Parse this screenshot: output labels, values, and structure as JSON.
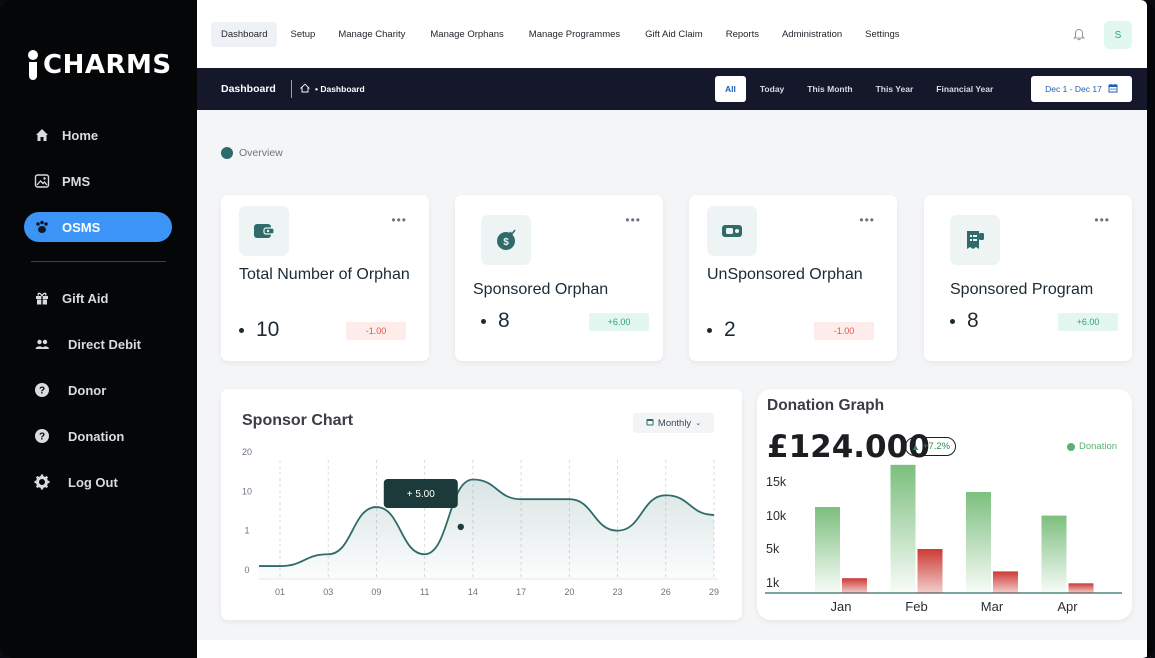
{
  "app": {
    "logo_text": "CHARMS"
  },
  "sidebar": {
    "items": [
      {
        "label": "Home",
        "icon": "home-icon",
        "active": false
      },
      {
        "label": "PMS",
        "icon": "image-icon",
        "active": false
      },
      {
        "label": "OSMS",
        "icon": "paw-icon",
        "active": true
      },
      {
        "label": "Gift Aid",
        "icon": "gift-icon",
        "active": false
      },
      {
        "label": "Direct Debit",
        "icon": "users-icon",
        "active": false
      },
      {
        "label": "Donor",
        "icon": "help-icon",
        "active": false
      },
      {
        "label": "Donation",
        "icon": "help-icon",
        "active": false
      },
      {
        "label": "Log Out",
        "icon": "gear-icon",
        "active": false
      }
    ]
  },
  "topnav": {
    "items": [
      "Dashboard",
      "Setup",
      "Manage Charity",
      "Manage Orphans",
      "Manage Programmes",
      "Gift Aid Claim",
      "Reports",
      "Administration",
      "Settings"
    ],
    "active": "Dashboard",
    "avatar_initial": "S"
  },
  "header": {
    "title": "Dashboard",
    "breadcrumb": "• Dashboard",
    "filters": [
      "All",
      "Today",
      "This Month",
      "This Year",
      "Financial Year"
    ],
    "active_filter": "All",
    "date_range": "Dec 1 - Dec 17"
  },
  "overview": {
    "label": "Overview"
  },
  "cards": [
    {
      "title": "Total Number of Orphan",
      "value": "10",
      "change": "-1.00",
      "trend": "neg",
      "icon": "wallet-icon"
    },
    {
      "title": "Sponsored Orphan",
      "value": "8",
      "change": "+6.00",
      "trend": "pos",
      "icon": "money-bag-icon"
    },
    {
      "title": "UnSponsored Orphan",
      "value": "2",
      "change": "-1.00",
      "trend": "neg",
      "icon": "cash-icon"
    },
    {
      "title": "Sponsored Program",
      "value": "8",
      "change": "+6.00",
      "trend": "pos",
      "icon": "receipt-icon"
    }
  ],
  "sponsor_chart": {
    "title": "Sponsor Chart",
    "period_label": "Monthly",
    "tooltip": "+ 5.00",
    "colors": {
      "line": "#2f6b6a",
      "tooltip_bg": "#1d3a3a"
    }
  },
  "donation_graph": {
    "title": "Donation Graph",
    "amount": "£124.000",
    "change": "+7.2%",
    "legend": "Donation",
    "colors": {
      "green": "#7cbf7e",
      "red": "#cc3a35"
    }
  },
  "chart_data": [
    {
      "type": "line",
      "title": "Sponsor Chart",
      "x": [
        "01",
        "03",
        "09",
        "11",
        "14",
        "17",
        "20",
        "23",
        "26",
        "29"
      ],
      "y_ticks": [
        "0",
        "1",
        "10",
        "20"
      ],
      "values": [
        0.1,
        0.4,
        1.6,
        0.4,
        2.3,
        1.8,
        1.8,
        1.0,
        1.9,
        1.4
      ],
      "highlight": {
        "x": "14",
        "label": "+ 5.00"
      }
    },
    {
      "type": "bar",
      "title": "Donation Graph",
      "categories": [
        "Jan",
        "Feb",
        "Mar",
        "Apr"
      ],
      "y_ticks": [
        "1k",
        "5k",
        "10k",
        "15k"
      ],
      "series": [
        {
          "name": "Donation",
          "values": [
            10000,
            15800,
            12200,
            8700
          ]
        },
        {
          "values": [
            1800,
            5300,
            2600,
            1200
          ]
        }
      ]
    }
  ]
}
